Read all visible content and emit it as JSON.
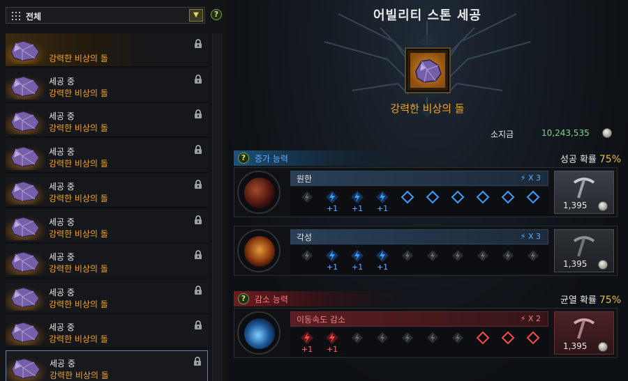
{
  "filter": {
    "label": "전체",
    "dropdown_icon": "chevron-down-icon",
    "help": "?"
  },
  "list": {
    "items": [
      {
        "status": "",
        "name": "강력한 비상의 돌"
      },
      {
        "status": "세공 중",
        "name": "강력한 비상의 돌"
      },
      {
        "status": "세공 중",
        "name": "강력한 비상의 돌"
      },
      {
        "status": "세공 중",
        "name": "강력한 비상의 돌"
      },
      {
        "status": "세공 중",
        "name": "강력한 비상의 돌"
      },
      {
        "status": "세공 중",
        "name": "강력한 비상의 돌"
      },
      {
        "status": "세공 중",
        "name": "강력한 비상의 돌"
      },
      {
        "status": "세공 중",
        "name": "강력한 비상의 돌"
      },
      {
        "status": "세공 중",
        "name": "강력한 비상의 돌"
      },
      {
        "status": "세공 중",
        "name": "강력한 비상의 돌"
      }
    ]
  },
  "main": {
    "title": "어빌리티 스톤 세공",
    "stone_name": "강력한 비상의 돌",
    "money_label": "소지금",
    "money_value": "10,243,535"
  },
  "increase": {
    "help": "?",
    "title": "증가 능력",
    "prob_label": "성공 확률",
    "prob_value": "75%",
    "abilities": [
      {
        "name": "원한",
        "count": "X 3",
        "price": "1,395",
        "slots": [
          "fail",
          "success",
          "success",
          "success",
          "empty",
          "empty",
          "empty",
          "empty",
          "empty",
          "empty"
        ],
        "labels": [
          "",
          "+1",
          "+1",
          "+1",
          "",
          "",
          "",
          "",
          "",
          ""
        ]
      },
      {
        "name": "각성",
        "count": "X 3",
        "price": "1,395",
        "slots": [
          "fail",
          "success",
          "success",
          "success",
          "fail",
          "fail",
          "fail",
          "fail",
          "fail",
          "fail"
        ],
        "labels": [
          "",
          "+1",
          "+1",
          "+1",
          "",
          "",
          "",
          "",
          "",
          ""
        ]
      }
    ]
  },
  "decrease": {
    "help": "?",
    "title": "감소 능력",
    "prob_label": "균열 확률",
    "prob_value": "75%",
    "abilities": [
      {
        "name": "이동속도 감소",
        "count": "X 2",
        "price": "1,395",
        "slots": [
          "success",
          "success",
          "fail",
          "fail",
          "fail",
          "fail",
          "fail",
          "empty",
          "empty",
          "empty"
        ],
        "labels": [
          "+1",
          "+1",
          "",
          "",
          "",
          "",
          "",
          "",
          "",
          ""
        ]
      }
    ]
  },
  "colors": {
    "blue_accent": "#5fb0ff",
    "red_accent": "#ff5a5a",
    "gold": "#f0a52a",
    "money": "#80d48a",
    "prob": "#e9c23a"
  }
}
